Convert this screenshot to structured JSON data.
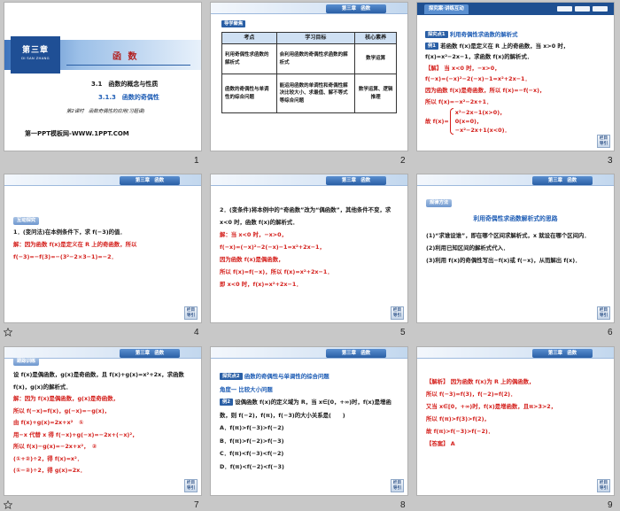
{
  "colors": {
    "canvas": "#c8c8c8",
    "theme_blue": "#2a5fa5",
    "answer_red": "#d41f1b",
    "heading_blue": "#1e5db5"
  },
  "slides": [
    {
      "number": "1",
      "chapter": "第三章",
      "chapter_pinyin": "DI SAN ZHANG",
      "title": "函 数",
      "section": "3.1　函数的概念与性质",
      "subsection": "3.1.3　函数的奇偶性",
      "lesson": "第2课时　函数奇偶性的应用(习题课)",
      "website": "第一PPT模板网-WWW.1PPT.COM"
    },
    {
      "number": "2",
      "tab": "第三章　函数",
      "badge": "导学聚焦",
      "table": {
        "headers": [
          "考点",
          "学习目标",
          "核心素养"
        ],
        "rows": [
          [
            "利用奇偶性求函数的解析式",
            "会利用函数的奇偶性求函数的解析式",
            "数学运算"
          ],
          [
            "函数的奇偶性与单调性的综合问题",
            "能运用函数的单调性和奇偶性解决比较大小、求最值、解不等式等综合问题",
            "数学运算、逻辑推理"
          ]
        ]
      }
    },
    {
      "number": "3",
      "header": "探究案·讲练互动",
      "point_badge": "探究点1",
      "point_title": "利用奇偶性求函数的解析式",
      "example_badge": "例1",
      "example_text": "若函数 f(x)是定义在 R 上的奇函数，当 x>0 时，f(x)=x²−2x−1，求函数 f(x)的解析式．",
      "solution_label": "【解】",
      "solution_lines": [
        "当 x<0 时，−x>0，",
        "f(−x)=(−x)²−2(−x)−1=x²+2x−1．",
        "因为函数 f(x)是奇函数，所以 f(x)=−f(−x)，",
        "所以 f(x)=−x²−2x+1．"
      ],
      "piecewise_prefix": "故 f(x)=",
      "piecewise": [
        "x²−2x−1(x>0)，",
        "0(x=0)，",
        "−x²−2x+1(x<0)．"
      ],
      "nav": "栏目导引"
    },
    {
      "number": "4",
      "indicator": "star-outline-icon",
      "tab": "第三章　函数",
      "badge": "互动探究",
      "question": "1．(变问法)在本例条件下，求 f(−3)的值．",
      "answer": "解：因为函数 f(x)是定义在 R 上的奇函数，所以 f(−3)=−f(3)=−(3²−2×3−1)=−2．",
      "nav": "栏目导引"
    },
    {
      "number": "5",
      "indicator": "star-outline-icon",
      "tab": "第三章　函数",
      "question": "2．(变条件)将本例中的“奇函数”改为“偶函数”，其他条件不变，求 x<0 时，函数 f(x)的解析式．",
      "answer_lines": [
        "解：当 x<0 时，−x>0，",
        "f(−x)=(−x)²−2(−x)−1=x²+2x−1，",
        "因为函数 f(x)是偶函数，",
        "所以 f(x)=f(−x)，所以 f(x)=x²+2x−1．",
        "即 x<0 时，f(x)=x²+2x−1．"
      ],
      "nav": "栏目导引"
    },
    {
      "number": "6",
      "indicator": "star-outline-icon",
      "tab": "第三章　函数",
      "badge": "规律方法",
      "heading": "利用奇偶性求函数解析式的思路",
      "items": [
        "(1)“求谁设谁”，即在哪个区间求解析式，x 就设在哪个区间内．",
        "(2)利用已知区间的解析式代入．",
        "(3)利用 f(x)的奇偶性写出−f(x)或 f(−x)，从而解出 f(x)．"
      ],
      "nav": "栏目导引"
    },
    {
      "number": "7",
      "indicator": "star-outline-icon",
      "tab": "第三章　函数",
      "badge": "跟踪训练",
      "question": "设 f(x)是偶函数，g(x)是奇函数，且 f(x)+g(x)=x²+2x，求函数 f(x)，g(x)的解析式．",
      "answer_lines": [
        "解：因为 f(x)是偶函数，g(x)是奇函数，",
        "所以 f(−x)=f(x)，g(−x)=−g(x)，",
        "由 f(x)+g(x)=2x+x²　①",
        "用−x 代替 x 得 f(−x)+g(−x)=−2x+(−x)²，",
        "所以 f(x)−g(x)=−2x+x²，　②",
        "(①+②)÷2，得 f(x)=x²．",
        "(①−②)÷2，得 g(x)=2x．"
      ],
      "nav": "栏目导引"
    },
    {
      "number": "8",
      "indicator": "star-outline-icon",
      "tab": "第三章　函数",
      "point_badge": "探究点2",
      "point_title": "函数的奇偶性与单调性的综合问题",
      "angle_label": "角度一",
      "angle_title": "比较大小问题",
      "example_badge": "例2",
      "example_text": "设偶函数 f(x)的定义域为 R，当 x∈[0，+∞)时，f(x)是增函数，则 f(−2)，f(π)，f(−3)的大小关系是(　　)",
      "options": [
        "A．f(π)>f(−3)>f(−2)",
        "B．f(π)>f(−2)>f(−3)",
        "C．f(π)<f(−3)<f(−2)",
        "D．f(π)<f(−2)<f(−3)"
      ],
      "nav": "栏目导引"
    },
    {
      "number": "9",
      "indicator": "star-outline-icon",
      "tab": "第三章　函数",
      "analysis_label": "【解析】",
      "analysis_lines": [
        "因为函数 f(x)为 R 上的偶函数，",
        "所以 f(−3)=f(3)，f(−2)=f(2)．",
        "又当 x∈[0，+∞)时，f(x)是增函数，且π>3>2，",
        "所以 f(π)>f(3)>f(2)，",
        "故 f(π)>f(−3)>f(−2)．"
      ],
      "answer_label": "【答案】",
      "answer_value": "A",
      "nav": "栏目导引"
    }
  ]
}
